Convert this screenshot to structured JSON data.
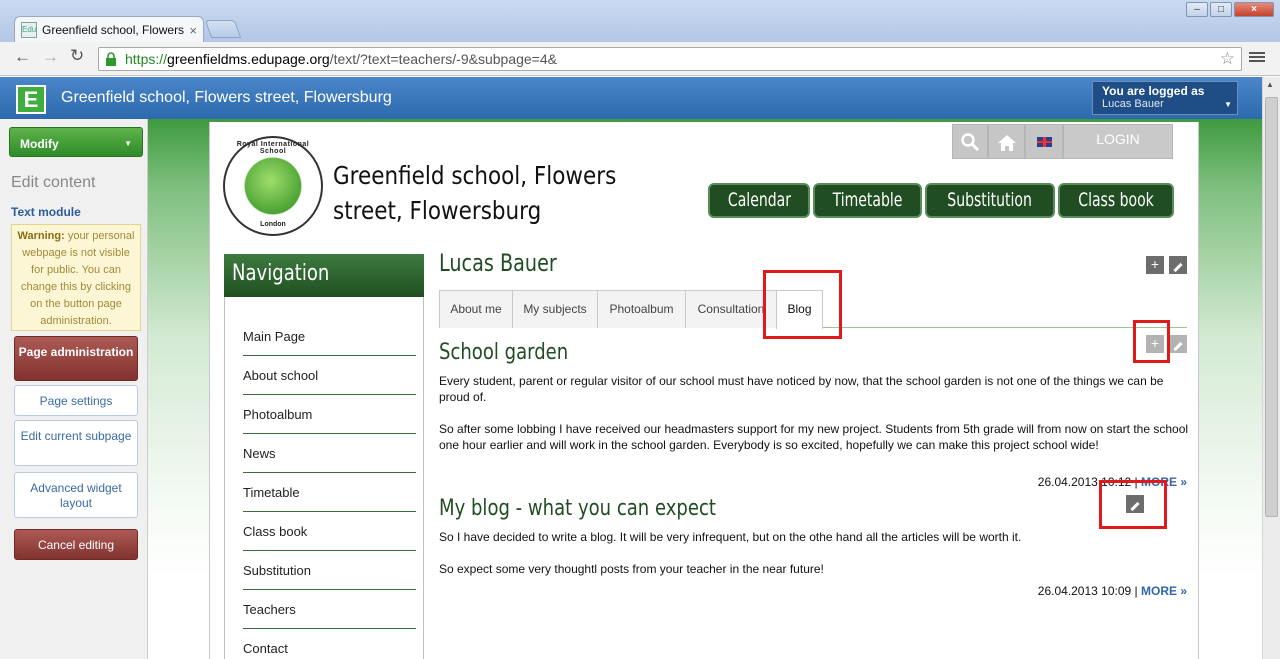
{
  "browser": {
    "tab_title": "Greenfield school, Flowers st",
    "favicon_text": "Edu",
    "url_scheme": "https://",
    "url_host": "greenfieldms.edupage.org",
    "url_path": "/text/?text=teachers/-9&subpage=4&"
  },
  "edupage": {
    "logo_letter": "E",
    "title": "Greenfield school, Flowers street, Flowersburg",
    "logged_label": "You are logged as",
    "logged_user": "Lucas Bauer"
  },
  "editpanel": {
    "modify": "Modify",
    "edit_content": "Edit content",
    "text_module": "Text module",
    "warning_bold": "Warning:",
    "warning_text": " your personal webpage is not visible for public. You can change this by clicking on the button page administration.",
    "page_admin": "Page administration",
    "page_settings": "Page settings",
    "edit_current": "Edit current subpage",
    "advanced_widget": "Advanced widget layout",
    "cancel_editing": "Cancel editing"
  },
  "school": {
    "logo_ring_top": "Royal International School",
    "logo_ring_bottom": "London",
    "name": "Greenfield school, Flowers street, Flowersburg",
    "login": "LOGIN"
  },
  "main_nav": {
    "calendar": "Calendar",
    "timetable": "Timetable",
    "substitution": "Substitution",
    "classbook": "Class book"
  },
  "navigation": {
    "title": "Navigation",
    "items": [
      "Main Page",
      "About school",
      "Photoalbum",
      "News",
      "Timetable",
      "Class book",
      "Substitution",
      "Teachers",
      "Contact"
    ]
  },
  "content": {
    "person": "Lucas Bauer",
    "tabs": [
      "About me",
      "My subjects",
      "Photoalbum",
      "Consultation",
      "Blog"
    ],
    "posts": [
      {
        "title": "School garden",
        "p1": "Every student, parent or regular visitor of our school must have noticed by now, that the school garden is not one of the things we can be proud of.",
        "p2": "So after some lobbing I have received our headmasters support for my new project. Students from 5th grade will from now on start the school one hour earlier and will work in the school garden. Everybody is so excited, hopefully we can make this project school wide!",
        "date": "26.04.2013 10:12",
        "more": "MORE »"
      },
      {
        "title": "My blog - what you can expect",
        "p1": "So I have decided to write a blog. It will be very infrequent, but on the othe hand all the articles will be worth it.",
        "p2": "So expect some very thoughtl posts from your teacher in the near future!",
        "date": "26.04.2013 10:09",
        "more": "MORE »"
      }
    ]
  },
  "colors": {
    "header_blue": "#2d6aad",
    "dark_green": "#204d22",
    "highlight_red": "#e01a1a"
  }
}
